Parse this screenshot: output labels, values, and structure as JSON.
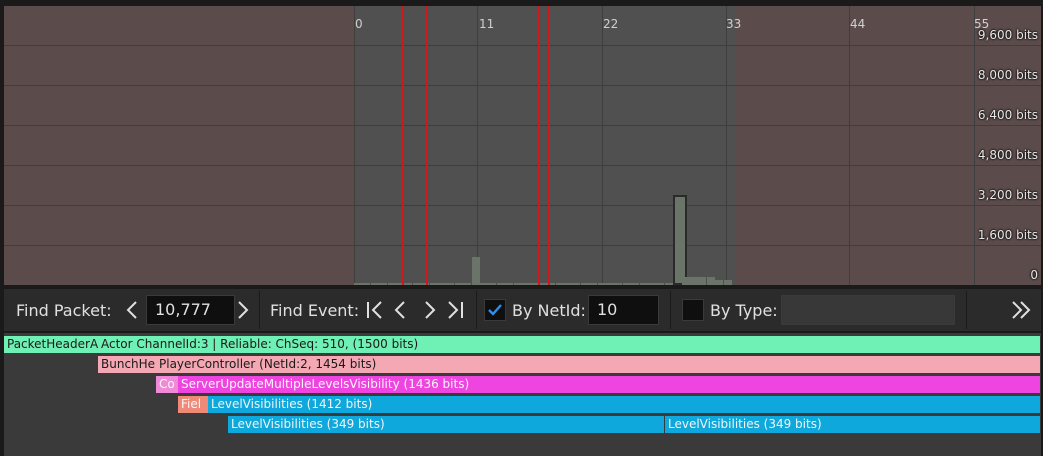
{
  "graph": {
    "x_ticks": [
      "0",
      "11",
      "22",
      "33",
      "44",
      "55"
    ],
    "y_ticks": [
      "9,600 bits",
      "8,000 bits",
      "6,400 bits",
      "4,800 bits",
      "3,200 bits",
      "1,600 bits",
      "0"
    ],
    "y_max_bits": 10000,
    "packet_sizes_bits": [
      80,
      40,
      40,
      30,
      30,
      30,
      30,
      30,
      40,
      30,
      40,
      30,
      30,
      30,
      1100,
      40,
      30,
      30,
      30,
      30,
      30,
      30,
      30,
      30,
      30,
      40,
      30,
      30,
      30,
      30,
      30,
      30,
      30,
      30,
      30,
      30,
      30,
      30,
      3600,
      300,
      300,
      300,
      300,
      200,
      200
    ],
    "selected_packet_index": 38,
    "colors": {
      "background": "#5c4b4b",
      "visible_range": "#505050",
      "bar": "#6b7469",
      "marker": "#d0181c"
    }
  },
  "toolbar": {
    "find_packet_label": "Find Packet:",
    "packet_value": "10,777",
    "find_event_label": "Find Event:",
    "by_netid_label": "By NetId:",
    "by_netid_checked": true,
    "netid_value": "10",
    "by_type_label": "By Type:",
    "by_type_checked": false,
    "type_value": ""
  },
  "events": [
    {
      "label": "PacketHeaderA",
      "color": "#6ff0b4"
    },
    {
      "label": "Actor ChannelId:3 | Reliable: ChSeq: 510,  (1500 bits)",
      "color": "#6ff0b4"
    },
    {
      "label": "BunchHe",
      "color": "#f4a8b4"
    },
    {
      "label": "PlayerController (NetId:2, 1454 bits)",
      "color": "#f4a8b4"
    },
    {
      "label": "Co",
      "color": "#f08ad8"
    },
    {
      "label": "ServerUpdateMultipleLevelsVisibility (1436 bits)",
      "color": "#ee44e0"
    },
    {
      "label": "Fiel",
      "color": "#f08a78"
    },
    {
      "label": "LevelVisibilities (1412 bits)",
      "color": "#0ea8dc"
    },
    {
      "label": "LevelVisibilities (349 bits)",
      "color": "#0ea8dc"
    },
    {
      "label": "LevelVisibilities (349 bits)",
      "color": "#0ea8dc"
    }
  ]
}
